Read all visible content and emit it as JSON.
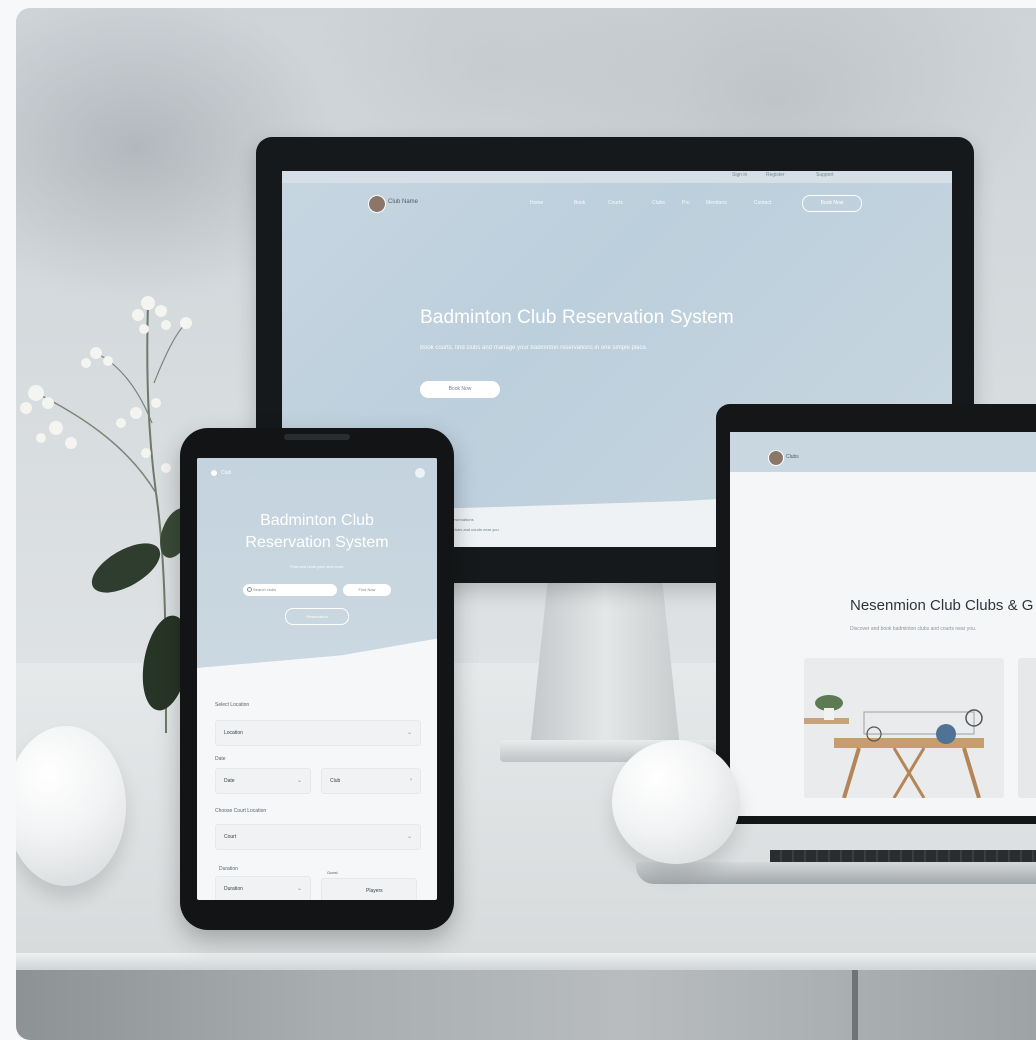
{
  "monitor": {
    "topbar_links": [
      "Sign in",
      "Register",
      "Support"
    ],
    "brand": "Club Name",
    "nav": [
      "Home",
      "Book",
      "Courts",
      "Clubs",
      "Pro",
      "Members",
      "Contact"
    ],
    "nav_button": "Book Now",
    "title": "Badminton Club Reservation System",
    "description": "Book courts, find clubs and manage your badminton reservations in one simple place.",
    "cta": "Book Now",
    "footer_title": "Recent reservations",
    "footer_text": "Popular clubs and courts near you"
  },
  "laptop": {
    "brand": "Clubs",
    "title": "Nesenmion Club Clubs & G",
    "description": "Discover and book badminton clubs and courts near you."
  },
  "phone": {
    "logo": "Club",
    "title_line1": "Badminton Club",
    "title_line2": "Reservation System",
    "subtitle": "Find and book your next court",
    "search_placeholder": "Search clubs",
    "find_button": "Find Now",
    "outline_button": "Reservation",
    "form": {
      "section1_label": "Select Location",
      "location_value": "Location",
      "date_label": "Date",
      "date_value": "Date",
      "time_value": "Club",
      "section2_label": "Choose Court Location",
      "court_value": "Court",
      "duration_label": "Duration",
      "duration_value": "Duration",
      "players_label": "Guest",
      "players_value": "Players"
    }
  },
  "colors": {
    "screen_blue": "#c7d6e1",
    "frame_dark": "#16191b",
    "wall": "#d5dadd"
  }
}
